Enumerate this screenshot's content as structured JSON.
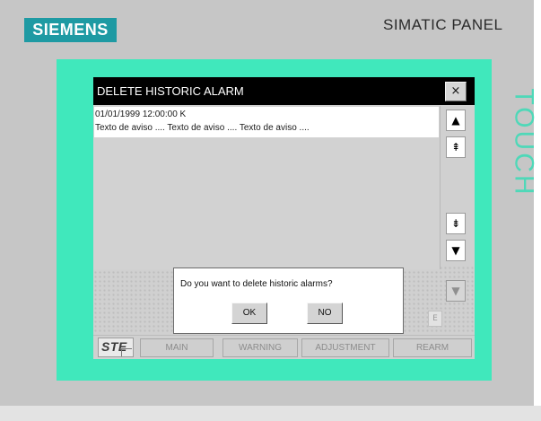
{
  "device": {
    "brand": "SIEMENS",
    "model": "SIMATIC PANEL",
    "bezel_label": "TOUCH",
    "brand_color": "#1e9aa3",
    "bezel_color": "#40e8bc"
  },
  "alarm_view": {
    "title": "DELETE HISTORIC ALARM",
    "close_icon": "×",
    "entries": [
      {
        "timestamp": "01/01/1999 12:00:00 K",
        "text": "Texto de aviso .... Texto de aviso .... Texto de aviso .... "
      }
    ],
    "scroll_buttons": {
      "line_up": "▲",
      "page_up": "⇞",
      "page_down": "⇟",
      "line_down": "▼",
      "extra_down": "▼"
    }
  },
  "confirm_dialog": {
    "message": "Do you want to delete historic alarms?",
    "ok_label": "OK",
    "no_label": "NO"
  },
  "small_box_label": "E",
  "nav_bar": {
    "logo_text": "STE",
    "tabs": [
      {
        "label": "MAIN"
      },
      {
        "label": "WARNING"
      },
      {
        "label": "ADJUSTMENT"
      },
      {
        "label": "REARM"
      }
    ]
  }
}
